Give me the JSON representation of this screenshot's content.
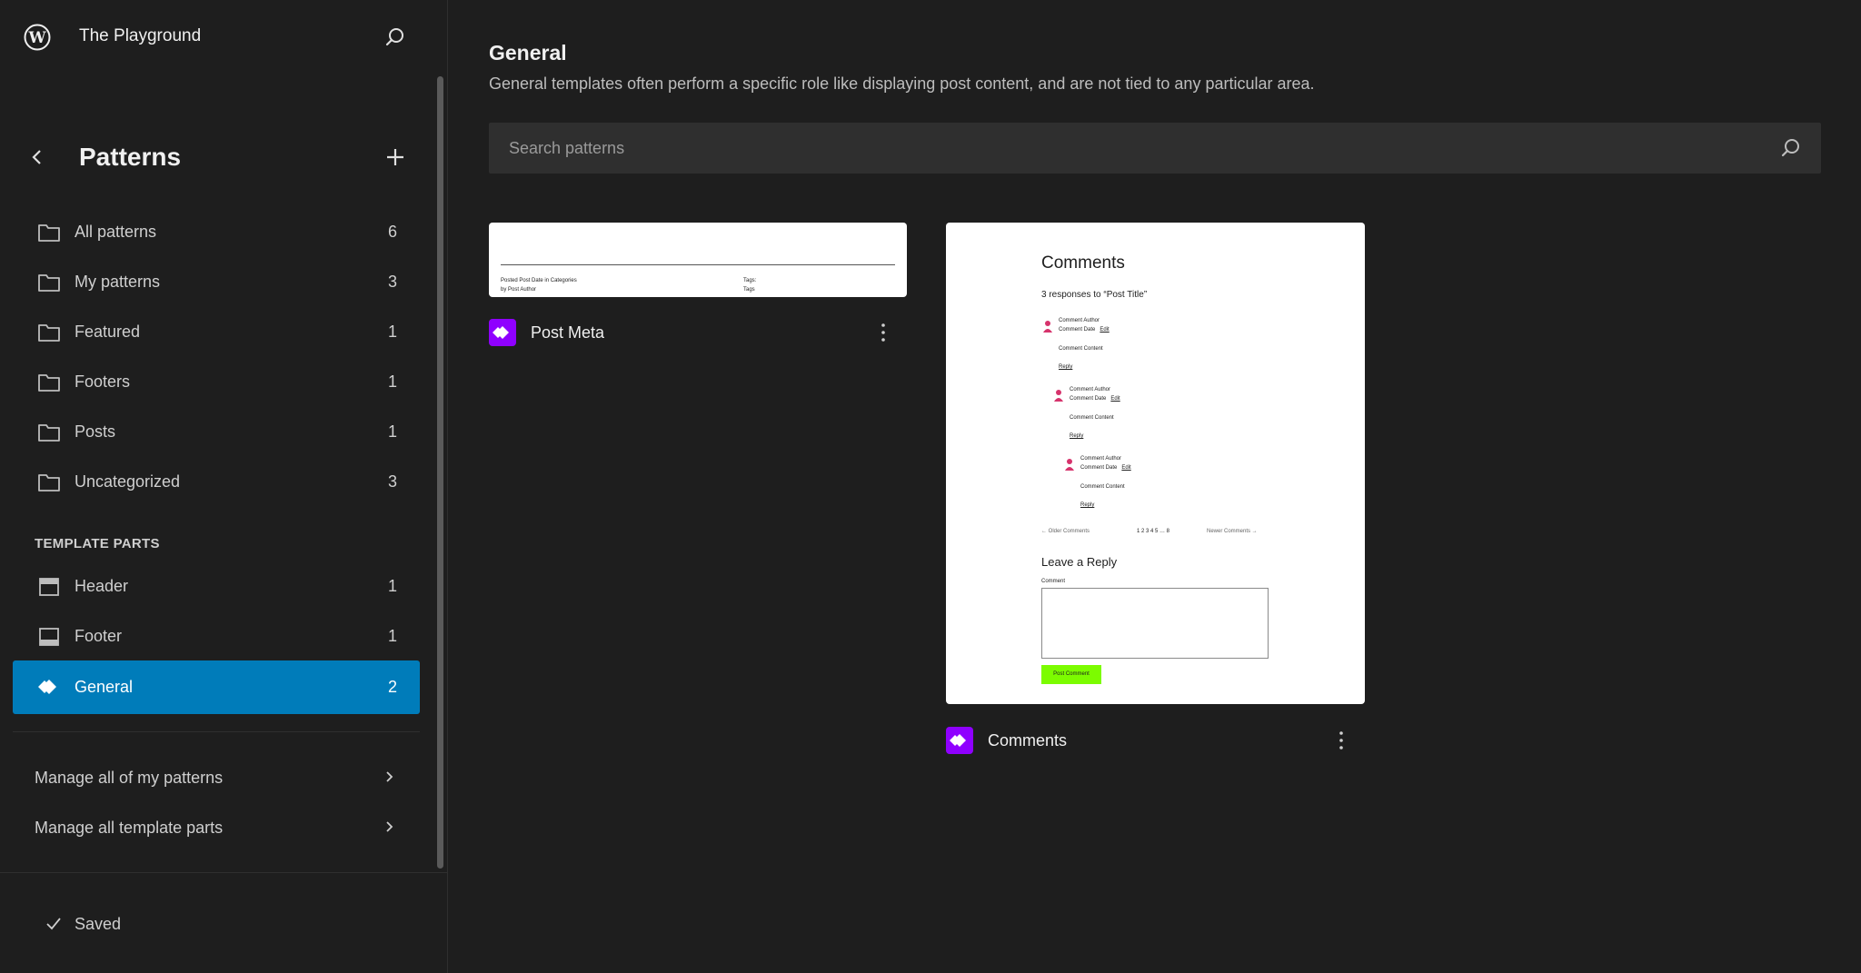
{
  "site": {
    "title": "The Playground"
  },
  "nav": {
    "title": "Patterns",
    "items": [
      {
        "label": "All patterns",
        "count": "6"
      },
      {
        "label": "My patterns",
        "count": "3"
      },
      {
        "label": "Featured",
        "count": "1"
      },
      {
        "label": "Footers",
        "count": "1"
      },
      {
        "label": "Posts",
        "count": "1"
      },
      {
        "label": "Uncategorized",
        "count": "3"
      }
    ],
    "template_parts_heading": "TEMPLATE PARTS",
    "template_parts": [
      {
        "label": "Header",
        "count": "1"
      },
      {
        "label": "Footer",
        "count": "1"
      },
      {
        "label": "General",
        "count": "2"
      }
    ],
    "manage_patterns": "Manage all of my patterns",
    "manage_parts": "Manage all template parts",
    "save_status": "Saved"
  },
  "main": {
    "title": "General",
    "description": "General templates often perform a specific role like displaying post content, and are not tied to any particular area.",
    "search_placeholder": "Search patterns",
    "cards": [
      {
        "title": "Post Meta",
        "preview": {
          "posted": "Posted",
          "post_date": "Post Date",
          "in": "in",
          "categories": "Categories",
          "by": "by",
          "post_author": "Post Author",
          "tags": "Tags:",
          "tags2": "Tags"
        }
      },
      {
        "title": "Comments",
        "preview": {
          "heading": "Comments",
          "responses": "3 responses to “Post Title”",
          "comment_author": "Comment Author",
          "comment_date": "Comment Date",
          "edit": "Edit",
          "comment_content": "Comment Content",
          "reply": "Reply",
          "older": "← Older Comments",
          "pages": "1 2 3 4 5 … 8",
          "newer": "Newer Comments →",
          "leave_reply": "Leave a Reply",
          "comment_label": "Comment",
          "post_comment": "Post Comment"
        }
      }
    ]
  },
  "colors": {
    "background": "#1e1e1e",
    "accent": "#007cba",
    "pattern_icon": "#8f00ff",
    "post_button": "#7cfc00",
    "avatar": "#d6336c"
  }
}
